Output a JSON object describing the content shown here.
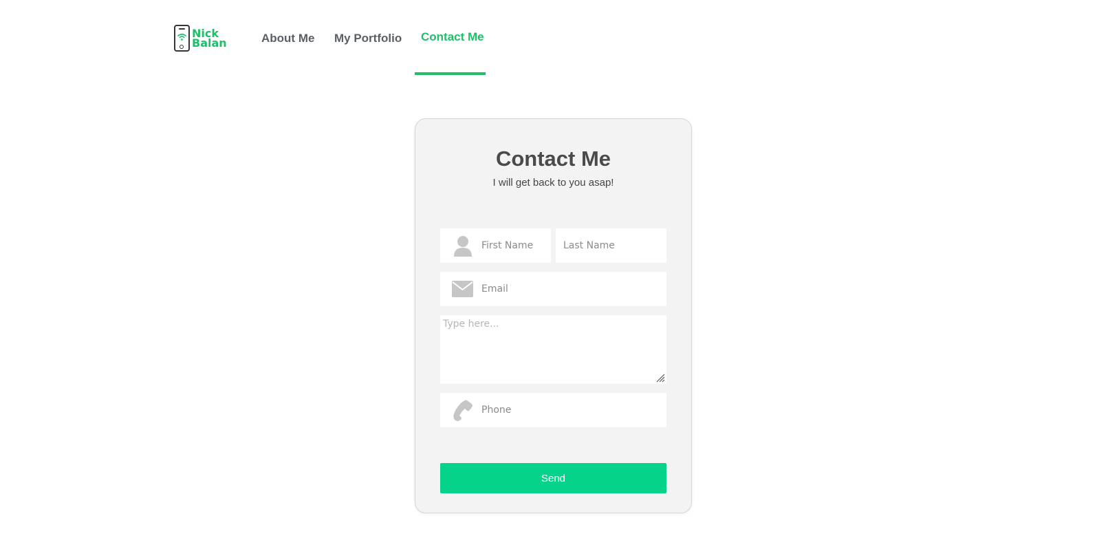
{
  "brand": {
    "name_line1": "Nick",
    "name_line2": "Balan",
    "accent_color": "#1fbf6a",
    "icon": "smartphone-wifi-icon"
  },
  "nav": {
    "items": [
      {
        "label": "About Me",
        "active": false
      },
      {
        "label": "My Portfolio",
        "active": false
      },
      {
        "label": "Contact Me",
        "active": true
      }
    ]
  },
  "form": {
    "title": "Contact Me",
    "subtitle": "I will get back to you asap!",
    "first_name": {
      "placeholder": "First Name",
      "value": "",
      "icon": "user-icon"
    },
    "last_name": {
      "placeholder": "Last Name",
      "value": ""
    },
    "email": {
      "placeholder": "Email",
      "value": "",
      "icon": "envelope-icon"
    },
    "message": {
      "placeholder": "Type here...",
      "value": ""
    },
    "phone": {
      "placeholder": "Phone",
      "value": "",
      "icon": "phone-icon"
    },
    "submit_label": "Send",
    "submit_color": "#05d38a"
  }
}
